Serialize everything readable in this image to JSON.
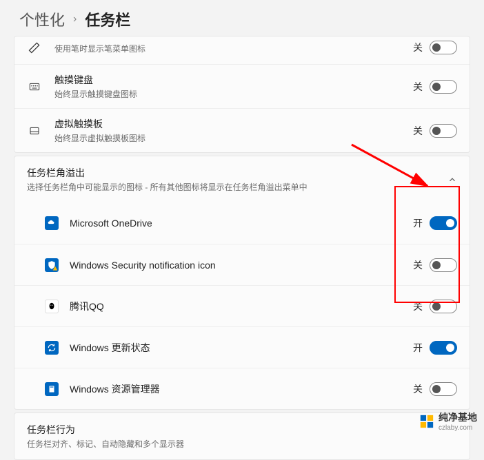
{
  "breadcrumb": {
    "parent": "个性化",
    "current": "任务栏"
  },
  "top_rows": [
    {
      "title": "使用笔时显示笔菜单图标",
      "sub": "",
      "state_label": "关",
      "on": false,
      "icon": "pen"
    },
    {
      "title": "触摸键盘",
      "sub": "始终显示触摸键盘图标",
      "state_label": "关",
      "on": false,
      "icon": "keyboard"
    },
    {
      "title": "虚拟触摸板",
      "sub": "始终显示虚拟触摸板图标",
      "state_label": "关",
      "on": false,
      "icon": "touchpad"
    }
  ],
  "overflow_section": {
    "title": "任务栏角溢出",
    "sub": "选择任务栏角中可能显示的图标 - 所有其他图标将显示在任务栏角溢出菜单中",
    "items": [
      {
        "label": "Microsoft OneDrive",
        "state_label": "开",
        "on": true,
        "icon_bg": "#0067c0",
        "icon": "onedrive"
      },
      {
        "label": "Windows Security notification icon",
        "state_label": "关",
        "on": false,
        "icon_bg": "#0067c0",
        "icon": "security"
      },
      {
        "label": "腾讯QQ",
        "state_label": "关",
        "on": false,
        "icon_bg": "#ffffff",
        "icon": "qq"
      },
      {
        "label": "Windows 更新状态",
        "state_label": "开",
        "on": true,
        "icon_bg": "#0067c0",
        "icon": "update"
      },
      {
        "label": "Windows 资源管理器",
        "state_label": "关",
        "on": false,
        "icon_bg": "#0067c0",
        "icon": "explorer"
      }
    ]
  },
  "behavior_section": {
    "title": "任务栏行为",
    "sub": "任务栏对齐、标记、自动隐藏和多个显示器"
  },
  "watermark": {
    "text": "纯净基地",
    "url": "czlaby.com"
  }
}
